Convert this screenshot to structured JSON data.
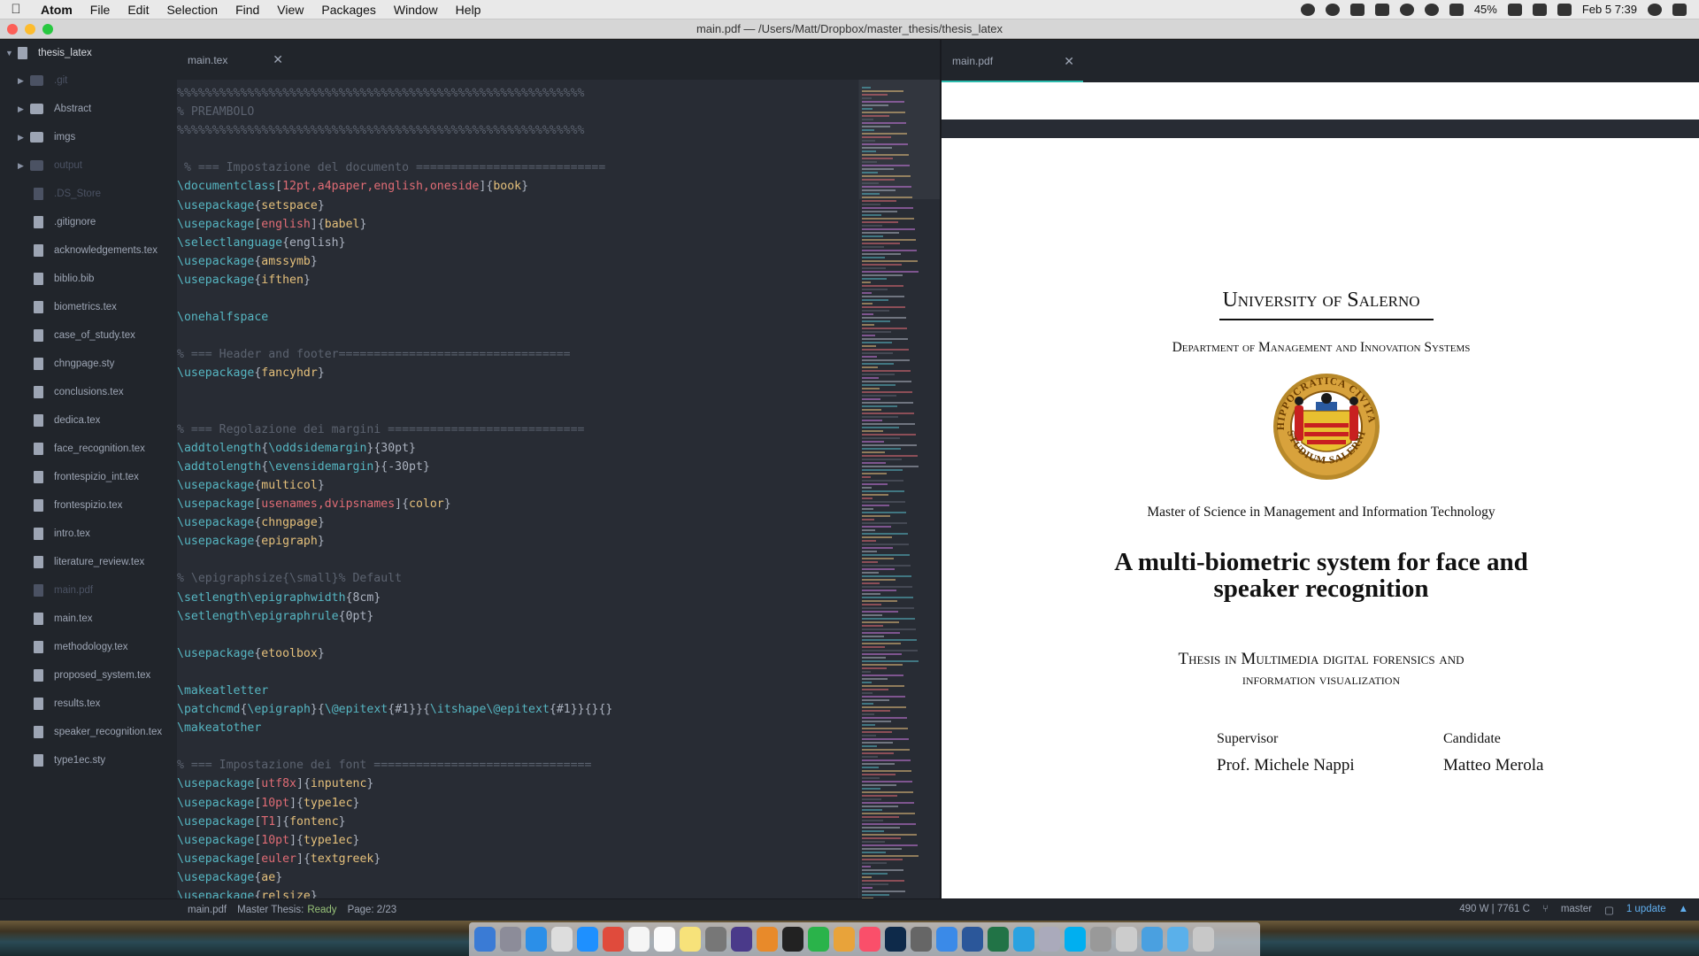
{
  "menubar": {
    "app_name": "Atom",
    "items": [
      "File",
      "Edit",
      "Selection",
      "Find",
      "View",
      "Packages",
      "Window",
      "Help"
    ],
    "battery": "45%",
    "datetime": "Feb 5  7:39"
  },
  "window": {
    "title": "main.pdf — /Users/Matt/Dropbox/master_thesis/thesis_latex"
  },
  "tree": {
    "root": "thesis_latex",
    "items": [
      {
        "label": ".git",
        "kind": "dir",
        "dim": true
      },
      {
        "label": "Abstract",
        "kind": "dir",
        "dim": false
      },
      {
        "label": "imgs",
        "kind": "dir",
        "dim": false
      },
      {
        "label": "output",
        "kind": "dir",
        "dim": true
      },
      {
        "label": ".DS_Store",
        "kind": "file",
        "dim": true
      },
      {
        "label": ".gitignore",
        "kind": "file",
        "dim": false
      },
      {
        "label": "acknowledgements.tex",
        "kind": "file",
        "dim": false
      },
      {
        "label": "biblio.bib",
        "kind": "file",
        "dim": false
      },
      {
        "label": "biometrics.tex",
        "kind": "file",
        "dim": false
      },
      {
        "label": "case_of_study.tex",
        "kind": "file",
        "dim": false
      },
      {
        "label": "chngpage.sty",
        "kind": "file",
        "dim": false
      },
      {
        "label": "conclusions.tex",
        "kind": "file",
        "dim": false
      },
      {
        "label": "dedica.tex",
        "kind": "file",
        "dim": false
      },
      {
        "label": "face_recognition.tex",
        "kind": "file",
        "dim": false
      },
      {
        "label": "frontespizio_int.tex",
        "kind": "file",
        "dim": false
      },
      {
        "label": "frontespizio.tex",
        "kind": "file",
        "dim": false
      },
      {
        "label": "intro.tex",
        "kind": "file",
        "dim": false
      },
      {
        "label": "literature_review.tex",
        "kind": "file",
        "dim": false
      },
      {
        "label": "main.pdf",
        "kind": "file",
        "dim": true
      },
      {
        "label": "main.tex",
        "kind": "file",
        "dim": false
      },
      {
        "label": "methodology.tex",
        "kind": "file",
        "dim": false
      },
      {
        "label": "proposed_system.tex",
        "kind": "file",
        "dim": false
      },
      {
        "label": "results.tex",
        "kind": "file",
        "dim": false
      },
      {
        "label": "speaker_recognition.tex",
        "kind": "file",
        "dim": false
      },
      {
        "label": "type1ec.sty",
        "kind": "file",
        "dim": false
      }
    ]
  },
  "editor": {
    "tab": "main.tex",
    "lines": [
      [
        [
          "c-com",
          "%%%%%%%%%%%%%%%%%%%%%%%%%%%%%%%%%%%%%%%%%%%%%%%%%%%%%%%%%%"
        ]
      ],
      [
        [
          "c-com",
          "% PREAMBOLO"
        ]
      ],
      [
        [
          "c-com",
          "%%%%%%%%%%%%%%%%%%%%%%%%%%%%%%%%%%%%%%%%%%%%%%%%%%%%%%%%%%"
        ]
      ],
      [],
      [
        [
          "c-com",
          " % === Impostazione del documento ==========================="
        ]
      ],
      [
        [
          "c-cmd",
          "\\documentclass"
        ],
        [
          "c-plain",
          "["
        ],
        [
          "c-opt",
          "12pt,a4paper,english,oneside"
        ],
        [
          "c-plain",
          "]{"
        ],
        [
          "c-arg",
          "book"
        ],
        [
          "c-plain",
          "}"
        ]
      ],
      [
        [
          "c-cmd",
          "\\usepackage"
        ],
        [
          "c-plain",
          "{"
        ],
        [
          "c-arg",
          "setspace"
        ],
        [
          "c-plain",
          "}"
        ]
      ],
      [
        [
          "c-cmd",
          "\\usepackage"
        ],
        [
          "c-plain",
          "["
        ],
        [
          "c-opt",
          "english"
        ],
        [
          "c-plain",
          "]{"
        ],
        [
          "c-arg",
          "babel"
        ],
        [
          "c-plain",
          "}"
        ]
      ],
      [
        [
          "c-cmd",
          "\\selectlanguage"
        ],
        [
          "c-plain",
          "{english}"
        ]
      ],
      [
        [
          "c-cmd",
          "\\usepackage"
        ],
        [
          "c-plain",
          "{"
        ],
        [
          "c-arg",
          "amssymb"
        ],
        [
          "c-plain",
          "}"
        ]
      ],
      [
        [
          "c-cmd",
          "\\usepackage"
        ],
        [
          "c-plain",
          "{"
        ],
        [
          "c-arg",
          "ifthen"
        ],
        [
          "c-plain",
          "}"
        ]
      ],
      [],
      [
        [
          "c-cmd",
          "\\onehalfspace"
        ]
      ],
      [],
      [
        [
          "c-com",
          "% === Header and footer================================="
        ]
      ],
      [
        [
          "c-cmd",
          "\\usepackage"
        ],
        [
          "c-plain",
          "{"
        ],
        [
          "c-arg",
          "fancyhdr"
        ],
        [
          "c-plain",
          "}"
        ]
      ],
      [],
      [],
      [
        [
          "c-com",
          "% === Regolazione dei margini ============================"
        ]
      ],
      [
        [
          "c-cmd",
          "\\addtolength"
        ],
        [
          "c-plain",
          "{"
        ],
        [
          "c-cmd",
          "\\oddsidemargin"
        ],
        [
          "c-plain",
          "}{30pt}"
        ]
      ],
      [
        [
          "c-cmd",
          "\\addtolength"
        ],
        [
          "c-plain",
          "{"
        ],
        [
          "c-cmd",
          "\\evensidemargin"
        ],
        [
          "c-plain",
          "}{-30pt}"
        ]
      ],
      [
        [
          "c-cmd",
          "\\usepackage"
        ],
        [
          "c-plain",
          "{"
        ],
        [
          "c-arg",
          "multicol"
        ],
        [
          "c-plain",
          "}"
        ]
      ],
      [
        [
          "c-cmd",
          "\\usepackage"
        ],
        [
          "c-plain",
          "["
        ],
        [
          "c-opt",
          "usenames,dvipsnames"
        ],
        [
          "c-plain",
          "]{"
        ],
        [
          "c-arg",
          "color"
        ],
        [
          "c-plain",
          "}"
        ]
      ],
      [
        [
          "c-cmd",
          "\\usepackage"
        ],
        [
          "c-plain",
          "{"
        ],
        [
          "c-arg",
          "chngpage"
        ],
        [
          "c-plain",
          "}"
        ]
      ],
      [
        [
          "c-cmd",
          "\\usepackage"
        ],
        [
          "c-plain",
          "{"
        ],
        [
          "c-arg",
          "epigraph"
        ],
        [
          "c-plain",
          "}"
        ]
      ],
      [],
      [
        [
          "c-com",
          "% \\epigraphsize{\\small}% Default"
        ]
      ],
      [
        [
          "c-cmd",
          "\\setlength"
        ],
        [
          "c-cmd",
          "\\epigraphwidth"
        ],
        [
          "c-plain",
          "{8cm}"
        ]
      ],
      [
        [
          "c-cmd",
          "\\setlength"
        ],
        [
          "c-cmd",
          "\\epigraphrule"
        ],
        [
          "c-plain",
          "{0pt}"
        ]
      ],
      [],
      [
        [
          "c-cmd",
          "\\usepackage"
        ],
        [
          "c-plain",
          "{"
        ],
        [
          "c-arg",
          "etoolbox"
        ],
        [
          "c-plain",
          "}"
        ]
      ],
      [],
      [
        [
          "c-cmd",
          "\\makeatletter"
        ]
      ],
      [
        [
          "c-cmd",
          "\\patchcmd"
        ],
        [
          "c-plain",
          "{"
        ],
        [
          "c-cmd",
          "\\epigraph"
        ],
        [
          "c-plain",
          "}{"
        ],
        [
          "c-cmd",
          "\\@epitext"
        ],
        [
          "c-plain",
          "{#1}}{"
        ],
        [
          "c-cmd",
          "\\itshape"
        ],
        [
          "c-cmd",
          "\\@epitext"
        ],
        [
          "c-plain",
          "{#1}}{}{}"
        ]
      ],
      [
        [
          "c-cmd",
          "\\makeatother"
        ]
      ],
      [],
      [
        [
          "c-com",
          "% === Impostazione dei font ==============================="
        ]
      ],
      [
        [
          "c-cmd",
          "\\usepackage"
        ],
        [
          "c-plain",
          "["
        ],
        [
          "c-opt",
          "utf8x"
        ],
        [
          "c-plain",
          "]{"
        ],
        [
          "c-arg",
          "inputenc"
        ],
        [
          "c-plain",
          "}"
        ]
      ],
      [
        [
          "c-cmd",
          "\\usepackage"
        ],
        [
          "c-plain",
          "["
        ],
        [
          "c-opt",
          "10pt"
        ],
        [
          "c-plain",
          "]{"
        ],
        [
          "c-arg",
          "type1ec"
        ],
        [
          "c-plain",
          "}"
        ]
      ],
      [
        [
          "c-cmd",
          "\\usepackage"
        ],
        [
          "c-plain",
          "["
        ],
        [
          "c-opt",
          "T1"
        ],
        [
          "c-plain",
          "]{"
        ],
        [
          "c-arg",
          "fontenc"
        ],
        [
          "c-plain",
          "}"
        ]
      ],
      [
        [
          "c-cmd",
          "\\usepackage"
        ],
        [
          "c-plain",
          "["
        ],
        [
          "c-opt",
          "10pt"
        ],
        [
          "c-plain",
          "]{"
        ],
        [
          "c-arg",
          "type1ec"
        ],
        [
          "c-plain",
          "}"
        ]
      ],
      [
        [
          "c-cmd",
          "\\usepackage"
        ],
        [
          "c-plain",
          "["
        ],
        [
          "c-opt",
          "euler"
        ],
        [
          "c-plain",
          "]{"
        ],
        [
          "c-arg",
          "textgreek"
        ],
        [
          "c-plain",
          "}"
        ]
      ],
      [
        [
          "c-cmd",
          "\\usepackage"
        ],
        [
          "c-plain",
          "{"
        ],
        [
          "c-arg",
          "ae"
        ],
        [
          "c-plain",
          "}"
        ]
      ],
      [
        [
          "c-cmd",
          "\\usepackage"
        ],
        [
          "c-plain",
          "{"
        ],
        [
          "c-arg",
          "relsize"
        ],
        [
          "c-plain",
          "}"
        ]
      ]
    ]
  },
  "pdf": {
    "tab": "main.pdf",
    "university": "University of Salerno",
    "department": "Department of Management and Innovation Systems",
    "seal_text_top": "HIPPOCRATICA CIVITAS",
    "seal_text_bottom": "STUDIUM SALERNI",
    "degree": "Master of Science in Management and Information Technology",
    "title_line1": "A multi-biometric system for face and",
    "title_line2": "speaker recognition",
    "thesis_line1": "Thesis in Multimedia digital forensics and",
    "thesis_line2": "information visualization",
    "supervisor_label": "Supervisor",
    "supervisor_name": "Prof. Michele Nappi",
    "candidate_label": "Candidate",
    "candidate_name": "Matteo Merola"
  },
  "status": {
    "file": "main.pdf",
    "project": "Master Thesis:",
    "state": "Ready",
    "page": "Page: 2/23",
    "stats": "490 W | 7761 C",
    "branch": "master",
    "updates": "1 update"
  }
}
